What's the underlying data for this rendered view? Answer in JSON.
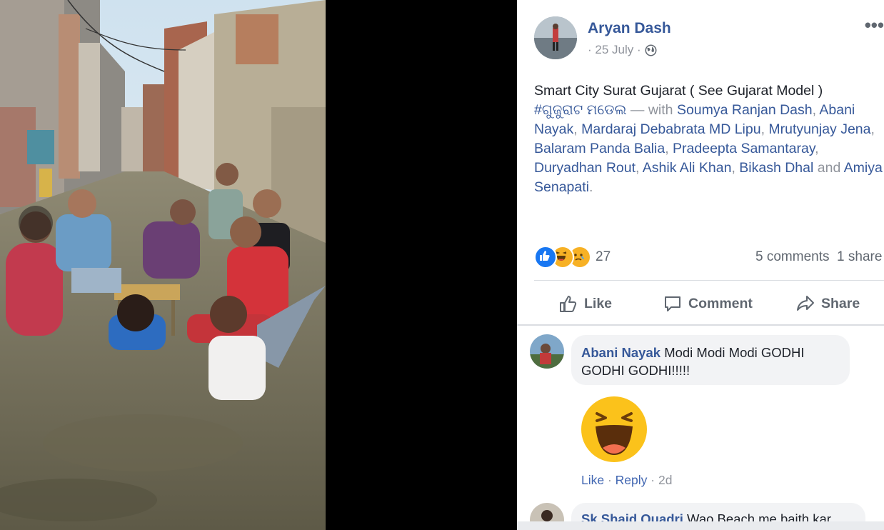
{
  "post": {
    "author": "Aryan Dash",
    "date": "· 25 July ·",
    "text_main": "Smart City Surat Gujarat ( See Gujarat Model )",
    "hashtag": "#ଗୁଜୁରାଟ ମଡେଲ",
    "with_prefix": " — with ",
    "tagged": [
      "Soumya Ranjan Dash",
      "Abani Nayak",
      "Mardaraj Debabrata MD Lipu",
      "Mrutyunjay Jena",
      "Balaram Panda Balia",
      "Pradeepta Samantaray",
      "Duryadhan Rout",
      "Ashik Ali Khan",
      "Bikash Dhal"
    ],
    "and_word": " and ",
    "last_tagged": "Amiya Senapati",
    "more_icon": "•••"
  },
  "reactions": {
    "count": "27",
    "comments": "5 comments",
    "shares": "1 share",
    "icons": [
      "like-icon",
      "haha-icon",
      "sad-icon"
    ],
    "colors": {
      "like": "#1877f2",
      "haha": "#f7b125",
      "sad": "#f7b125"
    }
  },
  "actions": {
    "like": "Like",
    "comment": "Comment",
    "share": "Share"
  },
  "comments": [
    {
      "author": "Abani Nayak",
      "text": "Modi Modi Modi GODHI GODHI GODHI!!!!!",
      "like": "Like",
      "reply": "Reply",
      "time": "2d"
    },
    {
      "author": "Sk Shaid Quadri",
      "text": "Wao Beach me baith kar"
    }
  ],
  "colors": {
    "link": "#365899",
    "muted": "#90949c",
    "bubble": "#f2f3f5"
  }
}
